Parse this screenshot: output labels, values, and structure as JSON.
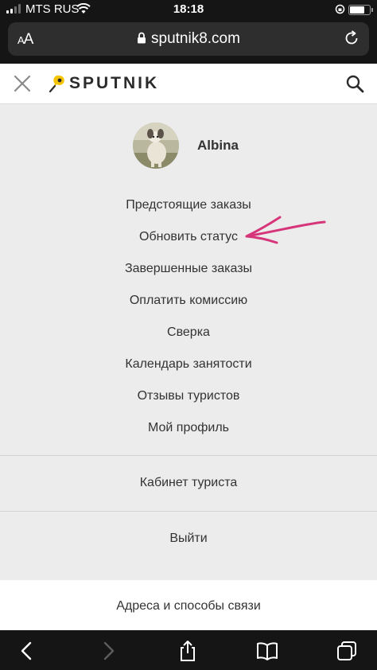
{
  "status_bar": {
    "carrier": "MTS RUS",
    "time": "18:18"
  },
  "browser": {
    "text_size_small": "A",
    "text_size_large": "A",
    "url": "sputnik8.com"
  },
  "header": {
    "logo_text": "SPUTNIK",
    "brand_color": "#f5c400"
  },
  "profile": {
    "name": "Albina"
  },
  "menu": {
    "items": [
      {
        "label": "Предстоящие заказы"
      },
      {
        "label": "Обновить статус"
      },
      {
        "label": "Завершенные заказы"
      },
      {
        "label": "Оплатить комиссию"
      },
      {
        "label": "Сверка"
      },
      {
        "label": "Календарь занятости"
      },
      {
        "label": "Отзывы туристов"
      },
      {
        "label": "Мой профиль"
      }
    ],
    "tourist_cabinet": "Кабинет туриста",
    "logout": "Выйти",
    "contacts": "Адреса и способы связи"
  },
  "annotation": {
    "arrow_color": "#d6357a"
  },
  "icons": {
    "close": "close-icon",
    "search": "search-icon",
    "back": "chevron-left-icon",
    "forward": "chevron-right-icon",
    "share": "share-icon",
    "bookmarks": "book-icon",
    "tabs": "tabs-icon",
    "lock": "lock-icon",
    "reload": "reload-icon"
  }
}
